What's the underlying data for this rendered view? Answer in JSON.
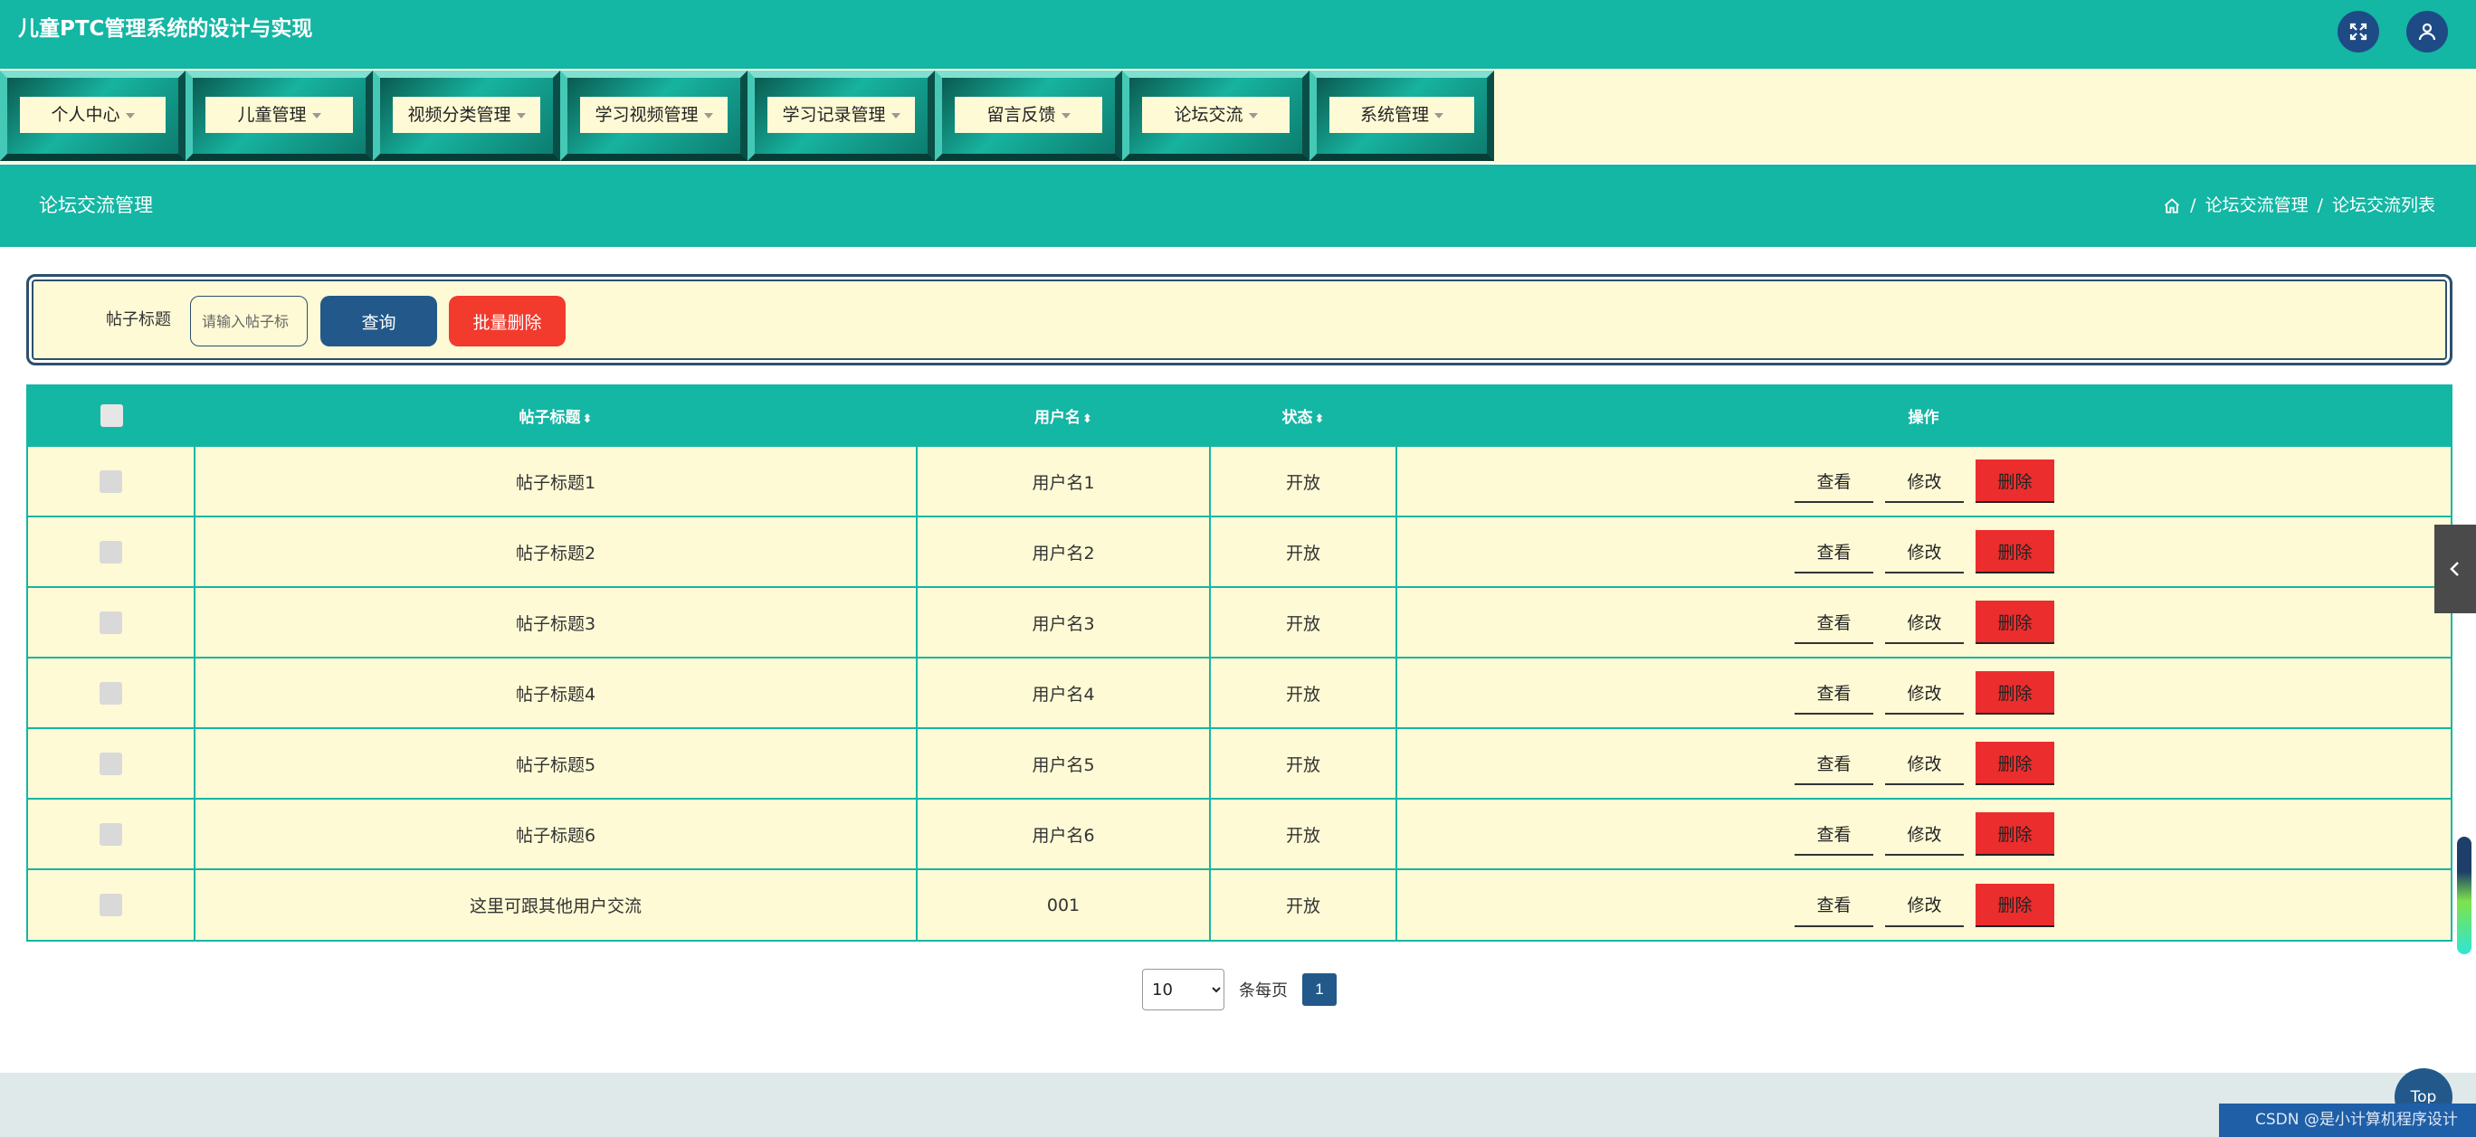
{
  "header": {
    "title": "儿童PTC管理系统的设计与实现"
  },
  "nav": [
    {
      "label": "个人中心"
    },
    {
      "label": "儿童管理"
    },
    {
      "label": "视频分类管理"
    },
    {
      "label": "学习视频管理"
    },
    {
      "label": "学习记录管理"
    },
    {
      "label": "留言反馈"
    },
    {
      "label": "论坛交流"
    },
    {
      "label": "系统管理"
    }
  ],
  "page": {
    "title": "论坛交流管理",
    "breadcrumb": [
      "论坛交流管理",
      "论坛交流列表"
    ]
  },
  "search": {
    "label": "帖子标题",
    "placeholder": "请输入帖子标",
    "query_label": "查询",
    "batch_delete_label": "批量删除"
  },
  "table": {
    "columns": [
      "帖子标题",
      "用户名",
      "状态",
      "操作"
    ],
    "sort_glyph": "⬍",
    "rows": [
      {
        "title": "帖子标题1",
        "user": "用户名1",
        "status": "开放"
      },
      {
        "title": "帖子标题2",
        "user": "用户名2",
        "status": "开放"
      },
      {
        "title": "帖子标题3",
        "user": "用户名3",
        "status": "开放"
      },
      {
        "title": "帖子标题4",
        "user": "用户名4",
        "status": "开放"
      },
      {
        "title": "帖子标题5",
        "user": "用户名5",
        "status": "开放"
      },
      {
        "title": "帖子标题6",
        "user": "用户名6",
        "status": "开放"
      },
      {
        "title": "这里可跟其他用户交流",
        "user": "001",
        "status": "开放"
      }
    ],
    "actions": {
      "view": "查看",
      "edit": "修改",
      "delete": "删除"
    }
  },
  "pagination": {
    "page_size": "10",
    "per_page_label": "条每页",
    "current_page": "1"
  },
  "floating": {
    "top_label": "Top",
    "watermark": "CSDN @是小计算机程序设计"
  },
  "colors": {
    "teal": "#14b6a4",
    "cream": "#fefad5",
    "navy": "#22598a",
    "red": "#ec2d2d"
  }
}
